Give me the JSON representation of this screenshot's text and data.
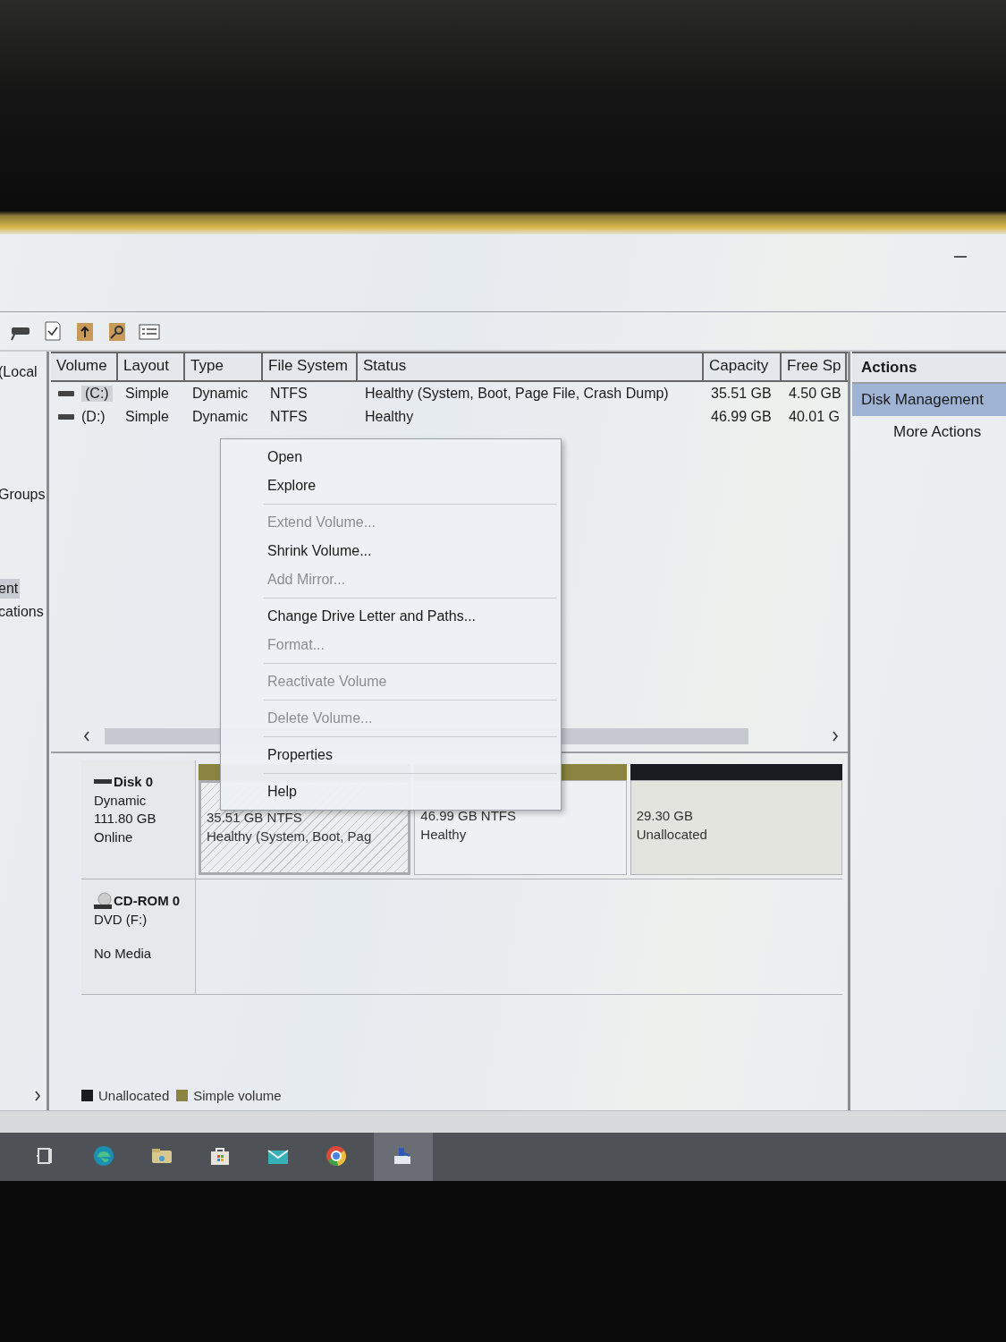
{
  "tree": {
    "items": [
      {
        "label": "(Local",
        "selected": false
      },
      {
        "label": "Groups",
        "selected": false
      },
      {
        "label": "ent",
        "selected": true
      },
      {
        "label": "cations",
        "selected": false
      }
    ]
  },
  "volumes": {
    "columns": [
      "Volume",
      "Layout",
      "Type",
      "File System",
      "Status",
      "Capacity",
      "Free Sp"
    ],
    "rows": [
      {
        "selected": true,
        "cells": [
          "(C:)",
          "Simple",
          "Dynamic",
          "NTFS",
          "Healthy (System, Boot, Page File, Crash Dump)",
          "35.51 GB",
          "4.50 GB"
        ]
      },
      {
        "selected": false,
        "cells": [
          "(D:)",
          "Simple",
          "Dynamic",
          "NTFS",
          "Healthy",
          "46.99 GB",
          "40.01 G"
        ]
      }
    ]
  },
  "context_menu": {
    "items": [
      {
        "kind": "item",
        "label": "Open",
        "disabled": false
      },
      {
        "kind": "item",
        "label": "Explore",
        "disabled": false
      },
      {
        "kind": "separator"
      },
      {
        "kind": "item",
        "label": "Extend Volume...",
        "disabled": true
      },
      {
        "kind": "item",
        "label": "Shrink Volume...",
        "disabled": false
      },
      {
        "kind": "item",
        "label": "Add Mirror...",
        "disabled": true
      },
      {
        "kind": "separator"
      },
      {
        "kind": "item",
        "label": "Change Drive Letter and Paths...",
        "disabled": false
      },
      {
        "kind": "item",
        "label": "Format...",
        "disabled": true
      },
      {
        "kind": "separator"
      },
      {
        "kind": "item",
        "label": "Reactivate Volume",
        "disabled": true
      },
      {
        "kind": "separator"
      },
      {
        "kind": "item",
        "label": "Delete Volume...",
        "disabled": true
      },
      {
        "kind": "separator"
      },
      {
        "kind": "item",
        "label": "Properties",
        "disabled": false
      },
      {
        "kind": "separator"
      },
      {
        "kind": "item",
        "label": "Help",
        "disabled": false
      }
    ]
  },
  "disks": [
    {
      "kind": "disk",
      "name": "Disk 0",
      "lines": [
        "Dynamic",
        "111.80 GB",
        "Online"
      ],
      "partitions": [
        {
          "kind": "simple",
          "color": "#8a8440",
          "selected": true,
          "lines": [
            "35.51 GB NTFS",
            "Healthy (System, Boot, Pag"
          ]
        },
        {
          "kind": "simple",
          "color": "#8a8440",
          "selected": false,
          "lines": [
            "46.99 GB NTFS",
            "Healthy"
          ]
        },
        {
          "kind": "unallocated",
          "color": "#1a1c22",
          "selected": false,
          "lines": [
            "29.30 GB",
            "Unallocated"
          ]
        }
      ]
    },
    {
      "kind": "cdrom",
      "name": "CD-ROM 0",
      "lines": [
        "DVD (F:)"
      ],
      "note": "No Media"
    }
  ],
  "legend": [
    {
      "label": "Unallocated",
      "color": "#1a1c22"
    },
    {
      "label": "Simple volume",
      "color": "#8a8440"
    }
  ],
  "actions": {
    "title": "Actions",
    "items": [
      {
        "kind": "section",
        "label": "Disk Management",
        "selected": true
      },
      {
        "kind": "action",
        "label": "More Actions",
        "selected": false
      }
    ]
  },
  "taskbar": {
    "items": [
      {
        "kind": "task-view",
        "selected": false
      },
      {
        "kind": "edge",
        "selected": false
      },
      {
        "kind": "folder",
        "selected": false
      },
      {
        "kind": "store",
        "selected": false
      },
      {
        "kind": "mail",
        "selected": false
      },
      {
        "kind": "chrome",
        "selected": false
      },
      {
        "kind": "disk",
        "selected": true
      }
    ]
  }
}
